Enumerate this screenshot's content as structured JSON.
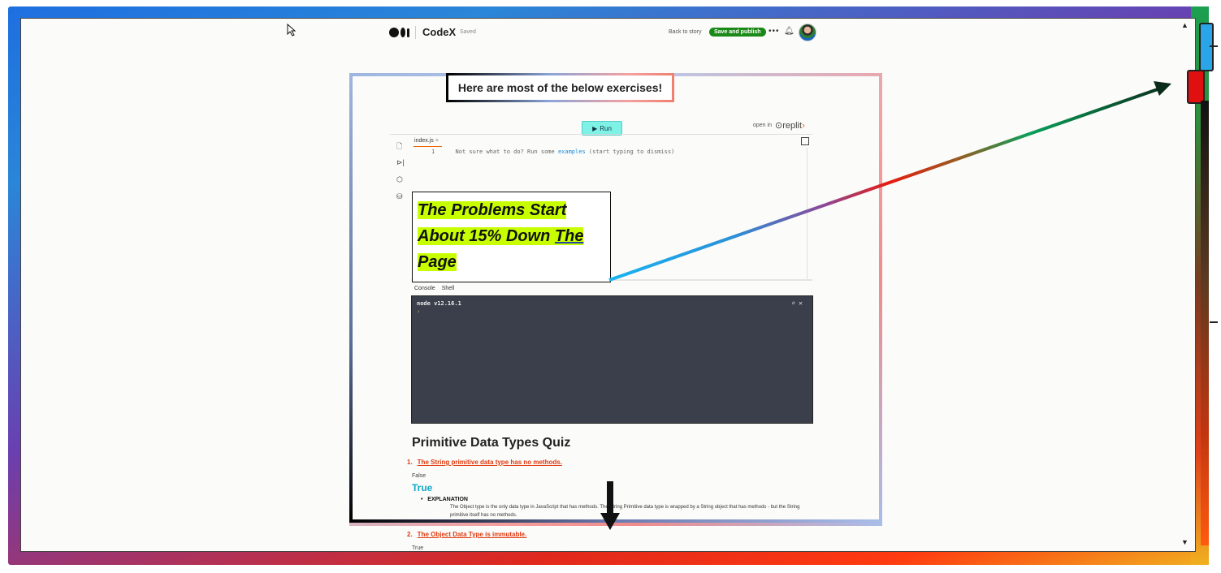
{
  "topbar": {
    "publication": "CodeX",
    "status": "Saved",
    "back_link": "Back to story",
    "publish_button": "Save and publish",
    "more": "•••"
  },
  "banner": {
    "text": "Here are most of the below exercises!"
  },
  "repl": {
    "run_label": "Run",
    "open_in": "open in",
    "brand": "replit",
    "file_tab": "index.js",
    "line_number": "1",
    "code_prefix": "Not sure what to do? Run some ",
    "code_keyword": "examples",
    "code_suffix": " (start typing to dismiss)",
    "console_tabs": [
      "Console",
      "Shell"
    ],
    "node_version": "node v12.16.1",
    "prompt": "›"
  },
  "annotation": {
    "line1": "The Problems Start",
    "line2": "About 15% Down",
    "line2b": "The",
    "line3": "Page"
  },
  "quiz": {
    "title": "Primitive Data Types Quiz",
    "q1_number": "1.",
    "q1_text": "The String primitive data type has no methods.",
    "q1_false": "False",
    "q1_true": "True",
    "explanation_label": "EXPLANATION",
    "explanation_text": "The Object type is the only data type in JavaScript that has methods. The String Primitive data type is wrapped by a String object that has methods - but the String primitive itself has no methods.",
    "q2_number": "2.",
    "q2_text": "The Object Data Type is immutable.",
    "q2_true": "True"
  },
  "colors": {
    "publish_green": "#1a8917",
    "highlight": "#c8ff00",
    "run_button": "#7ff2e6",
    "terminal_bg": "#3a3f4b",
    "quiz_red": "#e03a10",
    "true_teal": "#0fa8c8"
  },
  "icons": [
    "cursor-icon",
    "medium-logo-icon",
    "bell-icon",
    "file-icon",
    "debugger-icon",
    "packages-icon",
    "database-icon",
    "search-icon",
    "close-icon",
    "play-icon",
    "arrow-down-icon"
  ]
}
